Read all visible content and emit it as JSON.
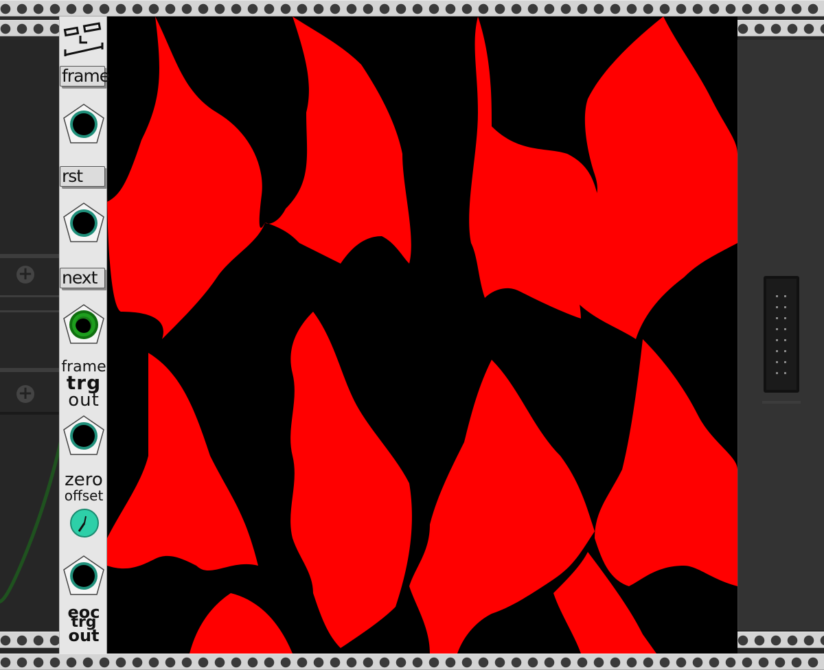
{
  "module": {
    "logo_icon": "op-art-logo",
    "buttons": [
      {
        "id": "frame",
        "label": "frame"
      },
      {
        "id": "rst",
        "label": "rst"
      },
      {
        "id": "next",
        "label": "next"
      }
    ],
    "frame_trg_out": {
      "line1": "frame",
      "line2": "trg",
      "line3": "out"
    },
    "zero_offset": {
      "line1": "zero",
      "line2": "offset"
    },
    "eoc_trg_out": {
      "line1": "eoc",
      "line2": "trg",
      "line3": "out"
    }
  },
  "display": {
    "colors": {
      "fill": "#ff0000",
      "background": "#000000"
    }
  },
  "colors": {
    "port_ring": "#1f8f7a",
    "knob": "#2ecfa8",
    "cable": "#1e5a1e",
    "rail": "#d4d4d4"
  },
  "icons": [
    "plus-icon",
    "plus-icon",
    "connector-icon"
  ]
}
